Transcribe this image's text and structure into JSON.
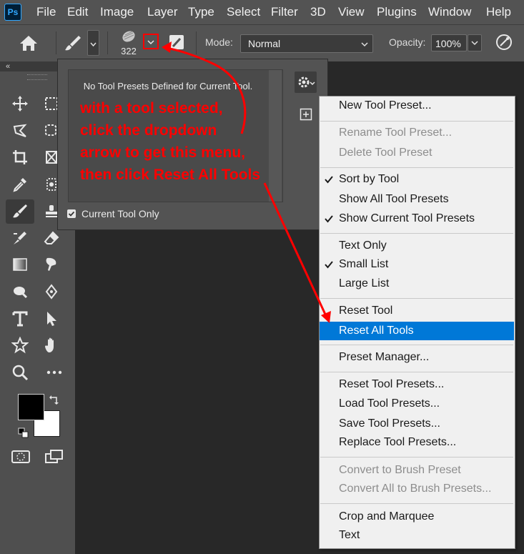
{
  "app": {
    "logo_text": "Ps"
  },
  "menubar": {
    "items": [
      "File",
      "Edit",
      "Image",
      "Layer",
      "Type",
      "Select",
      "Filter",
      "3D",
      "View",
      "Plugins",
      "Window",
      "Help"
    ]
  },
  "options": {
    "brush_size": "322",
    "mode_label": "Mode:",
    "mode_value": "Normal",
    "opacity_label": "Opacity:",
    "opacity_value": "100%"
  },
  "presets_panel": {
    "empty_message": "No Tool Presets Defined for Current Tool.",
    "current_tool_only_label": "Current Tool Only",
    "current_tool_only_checked": true
  },
  "annotation": {
    "color": "#ff0000",
    "lines": [
      "with a tool selected,",
      "click the dropdown",
      "arrow to get this menu,",
      "then click Reset All Tools"
    ]
  },
  "context_menu": {
    "highlight_color": "#0078d7",
    "items": [
      {
        "label": "New Tool Preset...",
        "enabled": true,
        "checked": false
      },
      {
        "label": "Rename Tool Preset...",
        "enabled": false,
        "checked": false
      },
      {
        "label": "Delete Tool Preset",
        "enabled": false,
        "checked": false
      },
      {
        "label": "Sort by Tool",
        "enabled": true,
        "checked": true
      },
      {
        "label": "Show All Tool Presets",
        "enabled": true,
        "checked": false
      },
      {
        "label": "Show Current Tool Presets",
        "enabled": true,
        "checked": true
      },
      {
        "label": "Text Only",
        "enabled": true,
        "checked": false
      },
      {
        "label": "Small List",
        "enabled": true,
        "checked": true
      },
      {
        "label": "Large List",
        "enabled": true,
        "checked": false
      },
      {
        "label": "Reset Tool",
        "enabled": true,
        "checked": false
      },
      {
        "label": "Reset All Tools",
        "enabled": true,
        "checked": false,
        "highlighted": true
      },
      {
        "label": "Preset Manager...",
        "enabled": true,
        "checked": false
      },
      {
        "label": "Reset Tool Presets...",
        "enabled": true,
        "checked": false
      },
      {
        "label": "Load Tool Presets...",
        "enabled": true,
        "checked": false
      },
      {
        "label": "Save Tool Presets...",
        "enabled": true,
        "checked": false
      },
      {
        "label": "Replace Tool Presets...",
        "enabled": true,
        "checked": false
      },
      {
        "label": "Convert to Brush Preset",
        "enabled": false,
        "checked": false
      },
      {
        "label": "Convert All to Brush Presets...",
        "enabled": false,
        "checked": false
      },
      {
        "label": "Crop and Marquee",
        "enabled": true,
        "checked": false
      },
      {
        "label": "Text",
        "enabled": true,
        "checked": false
      }
    ]
  },
  "toolbar": {
    "tools": [
      "move-icon",
      "marquee-icon",
      "lasso-icon",
      "object-select-icon",
      "crop-icon",
      "frame-icon",
      "eyedropper-icon",
      "spot-heal-icon",
      "brush-icon",
      "stamp-icon",
      "history-brush-icon",
      "eraser-icon",
      "gradient-icon",
      "smudge-icon",
      "dodge-icon",
      "pen-icon",
      "type-icon",
      "path-select-icon",
      "shape-icon",
      "hand-icon",
      "zoom-icon",
      "more-icon"
    ],
    "selected_tool": "brush-icon"
  }
}
